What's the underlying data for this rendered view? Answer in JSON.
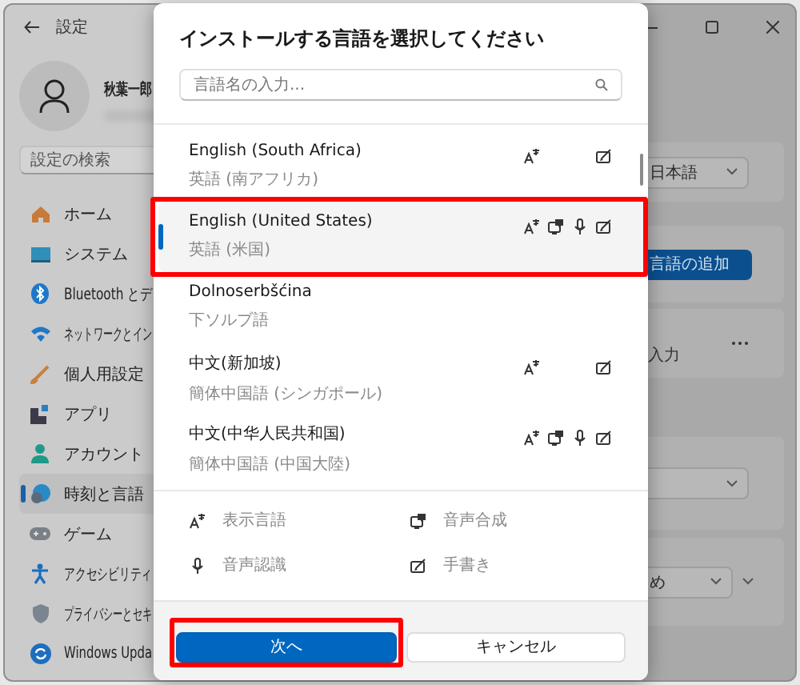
{
  "window": {
    "title": "設定"
  },
  "profile": {
    "name": "秋葉一郎"
  },
  "search": {
    "placeholder": "設定の検索"
  },
  "nav": [
    {
      "label": "ホーム",
      "selected": false
    },
    {
      "label": "システム",
      "selected": false
    },
    {
      "label": "Bluetooth とデ",
      "selected": false
    },
    {
      "label": "ネットワークとイン",
      "selected": false
    },
    {
      "label": "個人用設定",
      "selected": false
    },
    {
      "label": "アプリ",
      "selected": false
    },
    {
      "label": "アカウント",
      "selected": false
    },
    {
      "label": "時刻と言語",
      "selected": true
    },
    {
      "label": "ゲーム",
      "selected": false
    },
    {
      "label": "アクセシビリティ",
      "selected": false
    },
    {
      "label": "プライバシーとセキ",
      "selected": false
    },
    {
      "label": "Windows Upda",
      "selected": false
    }
  ],
  "background_panel": {
    "language_dropdown": "日本語",
    "add_language_button": "言語の追加",
    "input_label": "入力",
    "dropdown_value": "め"
  },
  "dialog": {
    "title": "インストールする言語を選択してください",
    "search": {
      "placeholder": "言語名の入力..."
    },
    "languages": [
      {
        "name": "English (South Africa)",
        "native": "英語 (南アフリカ)",
        "display_language": true,
        "text_to_speech": false,
        "speech_recognition": false,
        "handwriting": true,
        "selected": false,
        "highlighted": false
      },
      {
        "name": "English (United States)",
        "native": "英語 (米国)",
        "display_language": true,
        "text_to_speech": true,
        "speech_recognition": true,
        "handwriting": true,
        "selected": true,
        "highlighted": true
      },
      {
        "name": "Dolnoserbšćina",
        "native": "下ソルブ語",
        "display_language": false,
        "text_to_speech": false,
        "speech_recognition": false,
        "handwriting": false,
        "selected": false,
        "highlighted": false
      },
      {
        "name": "中文(新加坡)",
        "native": "簡体中国語 (シンガポール)",
        "display_language": true,
        "text_to_speech": false,
        "speech_recognition": false,
        "handwriting": true,
        "selected": false,
        "highlighted": false
      },
      {
        "name": "中文(中华人民共和国)",
        "native": "簡体中国語 (中国大陸)",
        "display_language": true,
        "text_to_speech": true,
        "speech_recognition": true,
        "handwriting": true,
        "selected": false,
        "highlighted": false
      }
    ],
    "legend": [
      {
        "kind": "display",
        "label": "表示言語"
      },
      {
        "kind": "tts",
        "label": "音声合成"
      },
      {
        "kind": "speech",
        "label": "音声認識"
      },
      {
        "kind": "handwriting",
        "label": "手書き"
      }
    ],
    "buttons": [
      {
        "kind": "primary",
        "label": "次へ",
        "highlighted": true
      },
      {
        "kind": "secondary",
        "label": "キャンセル",
        "highlighted": false
      }
    ]
  }
}
